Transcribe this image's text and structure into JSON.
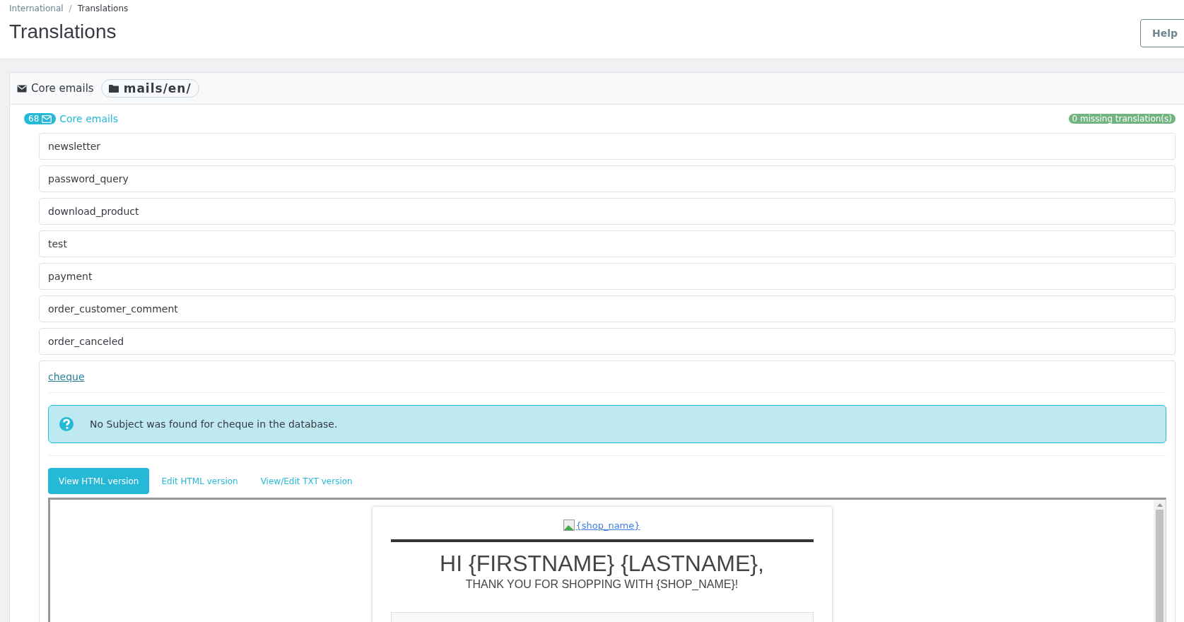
{
  "breadcrumb": [
    "International",
    "Translations"
  ],
  "breadcrumb_separator": "/",
  "title": "Translations",
  "help_button": "Help",
  "panel": {
    "title": "Core emails",
    "folder": "mails/en/"
  },
  "group": {
    "count": "68",
    "label": "Core emails",
    "missing": "0 missing translation(s)"
  },
  "templates": [
    {
      "name": "newsletter",
      "expanded": false
    },
    {
      "name": "password_query",
      "expanded": false
    },
    {
      "name": "download_product",
      "expanded": false
    },
    {
      "name": "test",
      "expanded": false
    },
    {
      "name": "payment",
      "expanded": false
    },
    {
      "name": "order_customer_comment",
      "expanded": false
    },
    {
      "name": "order_canceled",
      "expanded": false
    },
    {
      "name": "cheque",
      "expanded": true
    }
  ],
  "alert": "No Subject was found for cheque in the database.",
  "tabs": [
    {
      "label": "View HTML version",
      "selected": true
    },
    {
      "label": "Edit HTML version",
      "selected": false
    },
    {
      "label": "View/Edit TXT version",
      "selected": false
    }
  ],
  "preview": {
    "logo_alt": "{shop_name}",
    "heading": "HI {FIRSTNAME} {LASTNAME},",
    "subheading": "THANK YOU FOR SHOPPING WITH {SHOP_NAME}!"
  }
}
